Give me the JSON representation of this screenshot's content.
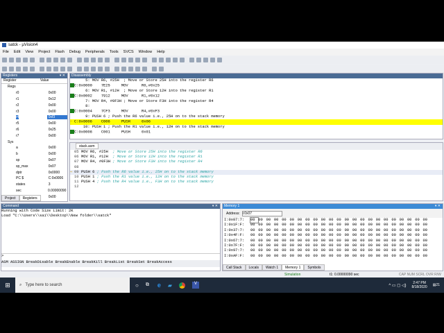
{
  "window": {
    "title": "satck - µVision4"
  },
  "menu": [
    "File",
    "Edit",
    "View",
    "Project",
    "Flash",
    "Debug",
    "Peripherals",
    "Tools",
    "SVCS",
    "Window",
    "Help"
  ],
  "registers": {
    "title": "Registers",
    "col_register": "Register",
    "col_value": "Value",
    "groups": [
      {
        "name": "Regs",
        "items": [
          [
            "r0",
            "0x00"
          ],
          [
            "r1",
            "0x12"
          ],
          [
            "r2",
            "0x00"
          ],
          [
            "r3",
            "0x00"
          ],
          [
            "r4",
            "0xf3"
          ],
          [
            "r5",
            "0x00"
          ],
          [
            "r6",
            "0x25"
          ],
          [
            "r7",
            "0x00"
          ]
        ]
      },
      {
        "name": "Sys",
        "items": [
          [
            "a",
            "0x00"
          ],
          [
            "b",
            "0x00"
          ],
          [
            "sp",
            "0x07"
          ],
          [
            "sp_max",
            "0x07"
          ],
          [
            "dptr",
            "0x0000"
          ],
          [
            "PC  $",
            "C:0x0006"
          ],
          [
            "states",
            "3"
          ],
          [
            "sec",
            "0.00000090"
          ],
          [
            "psw",
            "0x00"
          ]
        ]
      }
    ],
    "selected": "r4",
    "tabs": [
      "Project",
      "Registers"
    ]
  },
  "disassembly": {
    "title": "Disassembly",
    "lines": [
      {
        "t": "     5: MOV R6, #25H  ; Move or Store 25H into the register R6",
        "k": "src"
      },
      {
        "t": "C:0x0000    7E25     MOV      R6,#0x25",
        "k": "asm"
      },
      {
        "t": "     6: MOV R1, #12H  ; Move or Store 12H into the register R1",
        "k": "src"
      },
      {
        "t": "C:0x0002    7912     MOV      R1,#0x12",
        "k": "asm"
      },
      {
        "t": "     7: MOV R4, #0F3H ; Move or Store F3H into the register R4",
        "k": "src"
      },
      {
        "t": "     8: ",
        "k": "src"
      },
      {
        "t": "C:0x0004    7CF3     MOV      R4,#0xF3",
        "k": "asm"
      },
      {
        "t": "     9: PUSH 6 ; Push the R6 value i.e., 25H on to the stack memory",
        "k": "src"
      },
      {
        "t": "C:0x0006    C006     PUSH     0x06",
        "k": "cur"
      },
      {
        "t": "    10: PUSH 1 ; Push the R1 value i.e., 12H on to the stack memory",
        "k": "src"
      },
      {
        "t": "C:0x0008    C001     PUSH     0x01",
        "k": "asm"
      }
    ]
  },
  "editor": {
    "tab": "stack.asm",
    "lines": [
      {
        "n": "05",
        "code": "MOV R6, #25H  ",
        "c": "; Move or Store 25H into the register R6",
        "m": "g"
      },
      {
        "n": "06",
        "code": "MOV R1, #12H  ",
        "c": "; Move or Store 12H into the register R1",
        "m": "g"
      },
      {
        "n": "07",
        "code": "MOV R4, #0F3H ",
        "c": "; Move or Store F3H into the register R4",
        "m": "g"
      },
      {
        "n": "08",
        "code": "",
        "c": "",
        "m": ""
      },
      {
        "n": "09",
        "code": "PUSH 6 ",
        "c": "; Push the R6 value i.e., 25H on to the stack memory",
        "m": "cur"
      },
      {
        "n": "10",
        "code": "PUSH 1 ",
        "c": "; Push the R1 value i.e., 12H on to the stack memory",
        "m": ""
      },
      {
        "n": "11",
        "code": "PUSH 4 ",
        "c": "; Push the R4 value i.e., F3H on to the stack memory",
        "m": ""
      },
      {
        "n": "12",
        "code": "",
        "c": "",
        "m": ""
      }
    ]
  },
  "command": {
    "title": "Command",
    "output": [
      "Running with Code Size Limit: 2K",
      "Load \"C:\\\\Users\\\\sai\\\\Desktop\\\\New folder\\\\satck\""
    ],
    "prompt": ">",
    "hints": "ASM ASSIGN BreakDisable BreakEnable BreakKill BreakList BreakSet BreakAccess"
  },
  "memory": {
    "title": "Memory 1",
    "address_label": "Address:",
    "address_value": "i:0x07",
    "rows": [
      "I:0x07:7:",
      "I:0x1F:F:",
      "I:0x37:7:",
      "I:0x4F:F:",
      "I:0x67:7:",
      "I:0x7F:F:",
      "I:0x97:7:",
      "I:0xAF:F:"
    ],
    "cell": "00",
    "cols": 23,
    "tabs": [
      "Call Stack",
      "Locals",
      "Watch 1",
      "Memory 1",
      "Symbols"
    ],
    "active_tab": "Memory 1"
  },
  "status": {
    "mode": "Simulation",
    "time": "t1: 0.00000090 sec",
    "keys": "CAP  NUM  SCRL  OVR  R/W"
  },
  "taskbar": {
    "search_placeholder": "Type here to search",
    "time": "2:47 PM",
    "date": "8/18/2020",
    "notif": "21"
  }
}
